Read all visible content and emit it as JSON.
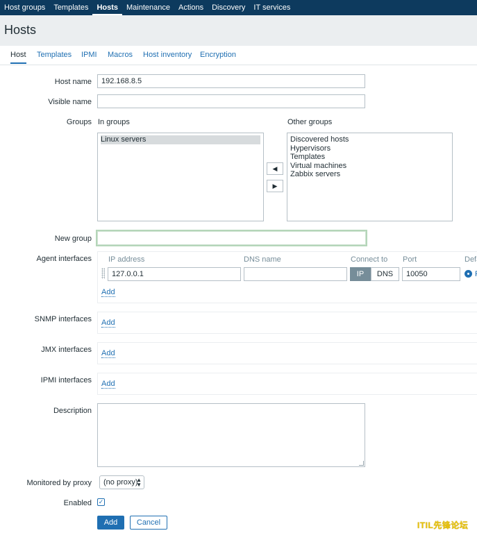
{
  "nav": {
    "items": [
      "Host groups",
      "Templates",
      "Hosts",
      "Maintenance",
      "Actions",
      "Discovery",
      "IT services"
    ],
    "active": "Hosts"
  },
  "page": {
    "title": "Hosts"
  },
  "tabs": [
    "Host",
    "Templates",
    "IPMI",
    "Macros",
    "Host inventory",
    "Encryption"
  ],
  "form": {
    "host_name_label": "Host name",
    "host_name_value": "192.168.8.5",
    "visible_name_label": "Visible name",
    "visible_name_value": "",
    "groups_label": "Groups",
    "in_groups_label": "In groups",
    "in_groups": [
      "Linux servers"
    ],
    "other_groups_label": "Other groups",
    "other_groups": [
      "Discovered hosts",
      "Hypervisors",
      "Templates",
      "Virtual machines",
      "Zabbix servers"
    ],
    "new_group_label": "New group",
    "new_group_value": "",
    "agent_interfaces_label": "Agent interfaces",
    "agent_iface": {
      "col_ip": "IP address",
      "col_dns": "DNS name",
      "col_connect": "Connect to",
      "col_port": "Port",
      "col_default": "Default",
      "ip_value": "127.0.0.1",
      "dns_value": "",
      "connect_ip": "IP",
      "connect_dns": "DNS",
      "port_value": "10050",
      "remove_label": "Remove"
    },
    "add_label": "Add",
    "snmp_interfaces_label": "SNMP interfaces",
    "jmx_interfaces_label": "JMX interfaces",
    "ipmi_interfaces_label": "IPMI interfaces",
    "description_label": "Description",
    "description_value": "",
    "proxy_label": "Monitored by proxy",
    "proxy_value": "(no proxy)",
    "enabled_label": "Enabled",
    "enabled": true,
    "add_button": "Add",
    "cancel_button": "Cancel"
  },
  "watermark": "ITIL先锋论坛",
  "colors": {
    "nav_bg": "#0d3a5e",
    "link": "#1f6fb2",
    "header_bg": "#ebeef0",
    "connect_active": "#768d99"
  }
}
